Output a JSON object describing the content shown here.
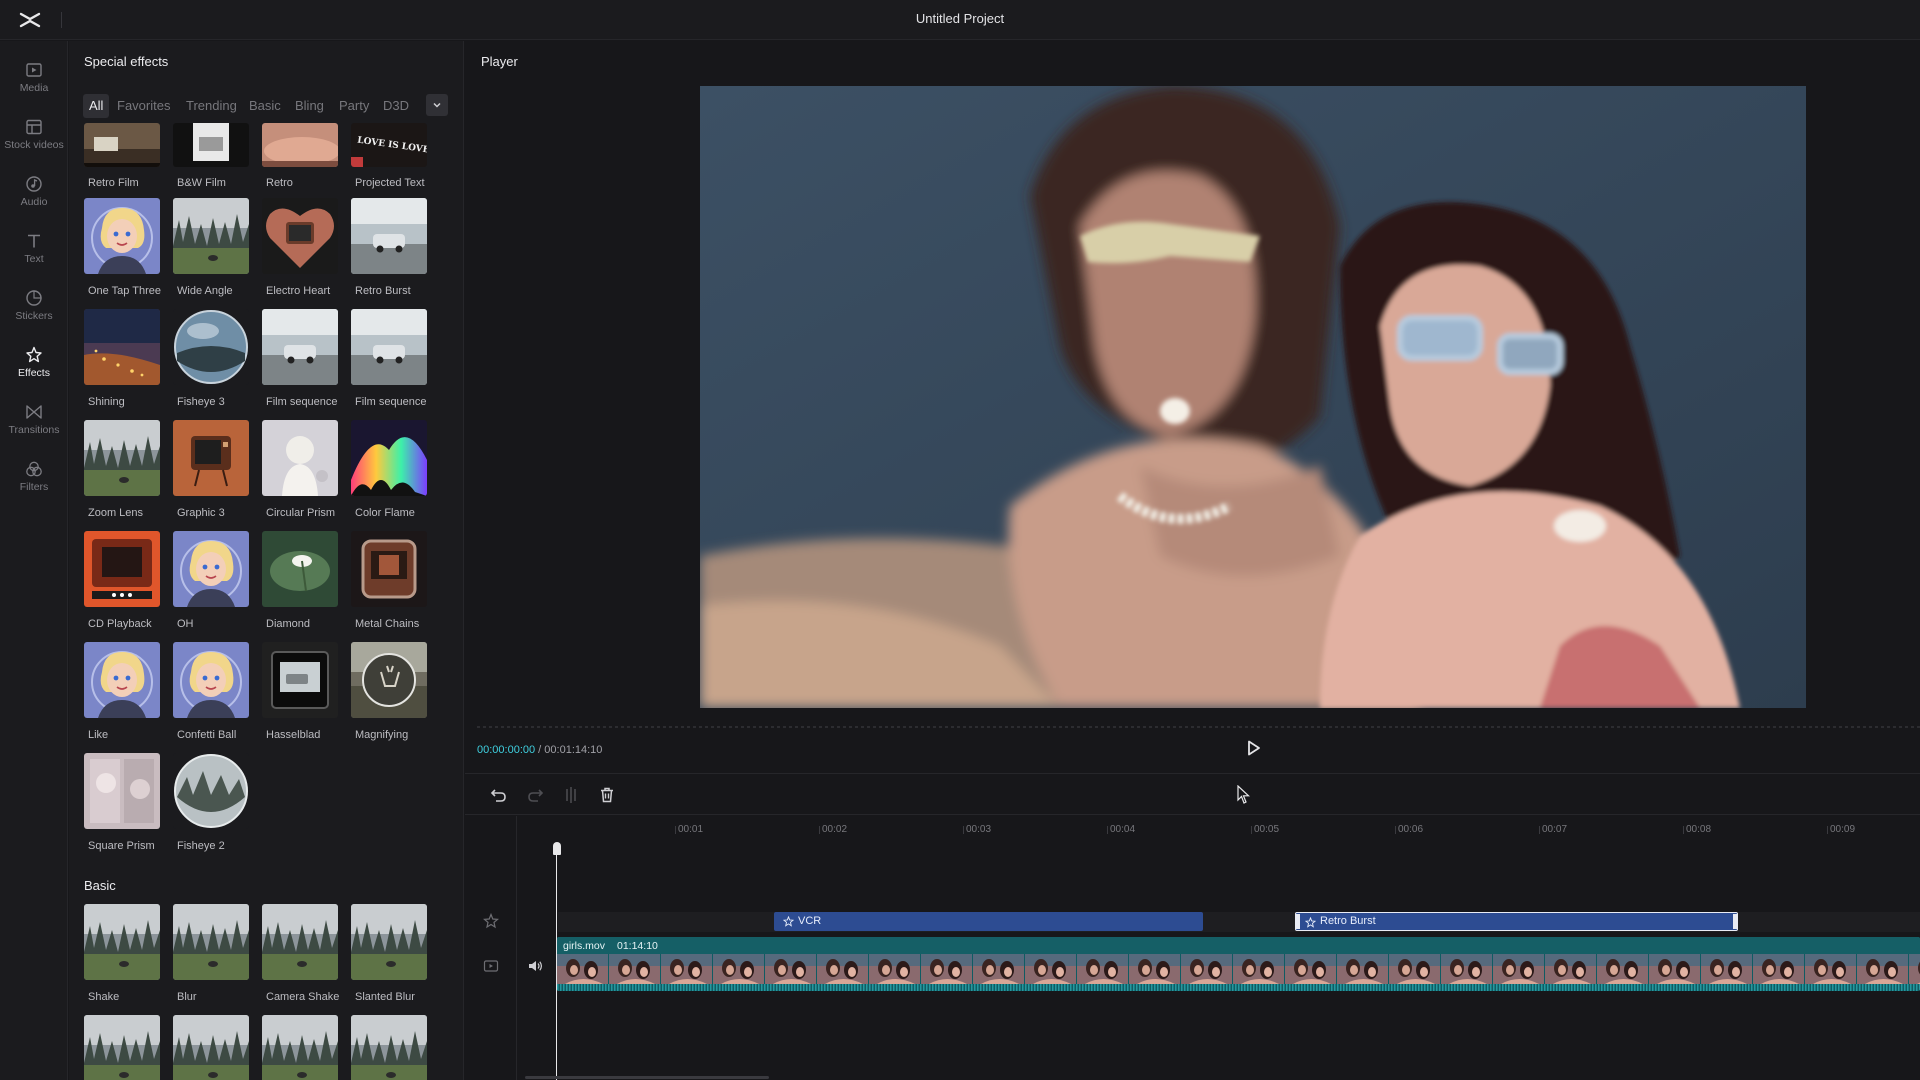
{
  "app": {
    "title": "Untitled Project",
    "logo_icon": "capcut-logo"
  },
  "nav": [
    {
      "label": "Media",
      "icon": "media-icon"
    },
    {
      "label": "Stock videos",
      "icon": "stock-videos-icon"
    },
    {
      "label": "Audio",
      "icon": "audio-icon"
    },
    {
      "label": "Text",
      "icon": "text-icon"
    },
    {
      "label": "Stickers",
      "icon": "stickers-icon"
    },
    {
      "label": "Effects",
      "icon": "effects-icon",
      "active": true
    },
    {
      "label": "Transitions",
      "icon": "transitions-icon"
    },
    {
      "label": "Filters",
      "icon": "filters-icon"
    }
  ],
  "effects_panel": {
    "title": "Special effects",
    "tabs": [
      "All",
      "Favorites",
      "Trending",
      "Basic",
      "Bling",
      "Party",
      "D3D"
    ],
    "active_tab": "All",
    "items": [
      {
        "label": "Retro Film"
      },
      {
        "label": "B&W Film"
      },
      {
        "label": "Retro"
      },
      {
        "label": "Projected Text",
        "overlay": "LOVE IS LOVE"
      },
      {
        "label": "One Tap Three"
      },
      {
        "label": "Wide Angle"
      },
      {
        "label": "Electro Heart"
      },
      {
        "label": "Retro Burst"
      },
      {
        "label": "Shining"
      },
      {
        "label": "Fisheye 3"
      },
      {
        "label": "Film sequence"
      },
      {
        "label": "Film sequence"
      },
      {
        "label": "Zoom Lens"
      },
      {
        "label": "Graphic 3"
      },
      {
        "label": "Circular Prism"
      },
      {
        "label": "Color Flame"
      },
      {
        "label": "CD Playback"
      },
      {
        "label": "OH"
      },
      {
        "label": "Diamond"
      },
      {
        "label": "Metal Chains"
      },
      {
        "label": "Like"
      },
      {
        "label": "Confetti Ball"
      },
      {
        "label": "Hasselblad"
      },
      {
        "label": "Magnifying"
      },
      {
        "label": "Square Prism"
      },
      {
        "label": "Fisheye 2"
      }
    ],
    "basic_section": {
      "title": "Basic",
      "items": [
        {
          "label": "Shake"
        },
        {
          "label": "Blur"
        },
        {
          "label": "Camera Shake"
        },
        {
          "label": "Slanted Blur"
        }
      ]
    }
  },
  "player": {
    "title": "Player",
    "current_time": "00:00:00:00",
    "separator": " / ",
    "total_time": "00:01:14:10"
  },
  "timeline": {
    "ruler_ticks": [
      "00:01",
      "00:02",
      "00:03",
      "00:04",
      "00:05",
      "00:06",
      "00:07",
      "00:08",
      "00:09"
    ],
    "effect_clips": [
      {
        "label": "VCR"
      },
      {
        "label": "Retro Burst",
        "selected": true
      }
    ],
    "video_track": {
      "name": "girls.mov",
      "duration": "01:14:10"
    }
  },
  "colors": {
    "accent_cyan": "#3fd0e0",
    "effect_clip": "#2d4c92",
    "video_track": "#0f5c63"
  }
}
